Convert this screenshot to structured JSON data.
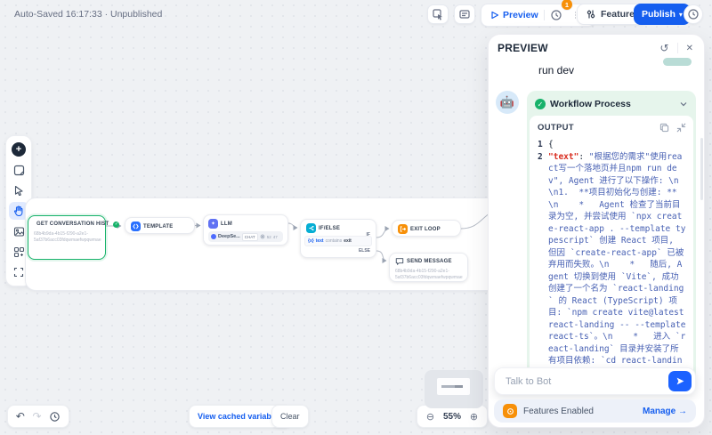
{
  "icons": {
    "plus": "+",
    "check": "✓",
    "refresh": "↺",
    "close": "✕",
    "undo": "↶",
    "redo": "↷",
    "zoom_out": "⊖",
    "zoom_in": "⊕",
    "chevron_down": "▾",
    "var": "{x}",
    "bot_avatar": "🤖",
    "llm_spark": "✦"
  },
  "topbar": {
    "status": "Auto-Saved 16:17:33 · Unpublished",
    "preview_label": "Preview",
    "checklist_badge": "1",
    "features_label": "Features",
    "publish_label": "Publish"
  },
  "canvas": {
    "zoom_level": "55%",
    "view_cached_label": "View cached variables",
    "clear_label": "Clear",
    "nodes": [
      {
        "title": "GET CONVERSATION HIST",
        "sub1": "68b4b9da-4b15-f290-a2e1-",
        "sub2": "5af37b6acc03fdqwmaefwpqwmae"
      },
      {
        "title": "TEMPLATE"
      },
      {
        "title": "LLM",
        "model": "DeepSe...",
        "mode": "CHAT",
        "meta1": "52",
        "meta2": "47"
      },
      {
        "title": "IF/ELSE",
        "if_label": "IF",
        "else_label": "ELSE",
        "cond_var": "text",
        "cond_op": "contains",
        "cond_val": "exit"
      },
      {
        "title": "EXIT LOOP"
      },
      {
        "title": "SEND MESSAGE",
        "sub1": "68b4b9da-4b15-f290-a2e1-",
        "sub2": "5af37b6acc03fdqwmaefwpqwmae"
      }
    ]
  },
  "panel": {
    "title": "PREVIEW",
    "user_message": "run dev",
    "workflow_process_label": "Workflow Process",
    "output_label": "OUTPUT",
    "code": {
      "ln1": "1",
      "ln2": "2",
      "line1": "{",
      "key": "\"text\"",
      "sep": ": ",
      "value": "\"根据您的需求\"使用react写一个落地页并且npm run dev\", Agent 进行了以下操作: \\n\\n1.  **项目初始化与创建: **\\n    *   Agent 检查了当前目录为空, 并尝试使用 `npx create-react-app . --template typescript` 创建 React 项目, 但因 `create-react-app` 已被弃用而失败。\\n    *   随后, Agent 切换到使用 `Vite`, 成功创建了一个名为 `react-landing` 的 React (TypeScript) 项目: `npm create vite@latest react-landing -- --template react-ts`。\\n    *   进入 `react-landing` 目录并安装了所有项目依赖: `cd react-landing && npm install`。"
    },
    "input_placeholder": "Talk to Bot",
    "footer_label": "Features Enabled",
    "manage_label": "Manage →"
  }
}
